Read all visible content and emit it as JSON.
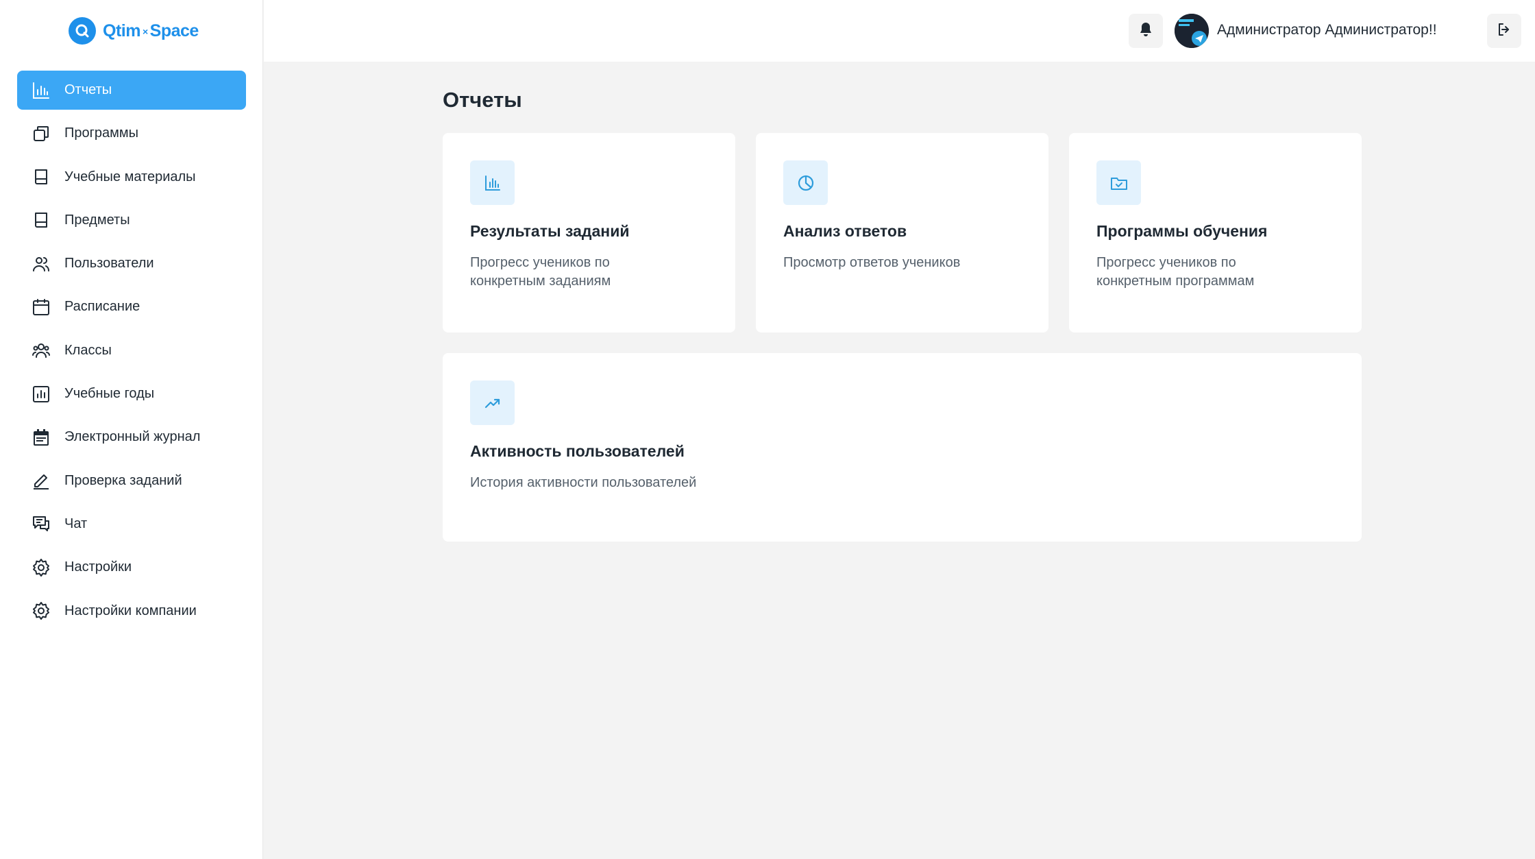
{
  "brand": {
    "name_left": "Qtim",
    "name_sep": "×",
    "name_right": "Space",
    "color": "#1e90ea"
  },
  "sidebar": {
    "items": [
      {
        "label": "Отчеты",
        "icon": "bar-chart-icon",
        "active": true
      },
      {
        "label": "Программы",
        "icon": "copy-icon"
      },
      {
        "label": "Учебные материалы",
        "icon": "book-icon"
      },
      {
        "label": "Предметы",
        "icon": "book-icon"
      },
      {
        "label": "Пользователи",
        "icon": "users-icon"
      },
      {
        "label": "Расписание",
        "icon": "calendar-icon"
      },
      {
        "label": "Классы",
        "icon": "group-icon"
      },
      {
        "label": "Учебные годы",
        "icon": "chart-square-icon"
      },
      {
        "label": "Электронный журнал",
        "icon": "calendar-filled-icon"
      },
      {
        "label": "Проверка заданий",
        "icon": "pencil-icon"
      },
      {
        "label": "Чат",
        "icon": "chat-icon"
      },
      {
        "label": "Настройки",
        "icon": "gear-icon"
      },
      {
        "label": "Настройки компании",
        "icon": "gear-icon"
      }
    ],
    "active_color": "#3ba7f5"
  },
  "header": {
    "user_name": "Администратор Администратор!!",
    "notifications_icon": "bell-icon",
    "logout_icon": "logout-icon"
  },
  "main": {
    "title": "Отчеты",
    "cards": [
      {
        "title": "Результаты заданий",
        "description": "Прогресс учеников по конкретным заданиям",
        "icon": "bar-chart-icon"
      },
      {
        "title": "Анализ ответов",
        "description": "Просмотр ответов учеников",
        "icon": "pie-chart-icon"
      },
      {
        "title": "Программы обучения",
        "description": "Прогресс учеников по конкретным программам",
        "icon": "folder-check-icon"
      },
      {
        "title": "Активность пользователей",
        "description": "История активности пользователей",
        "icon": "trend-up-icon"
      }
    ]
  }
}
